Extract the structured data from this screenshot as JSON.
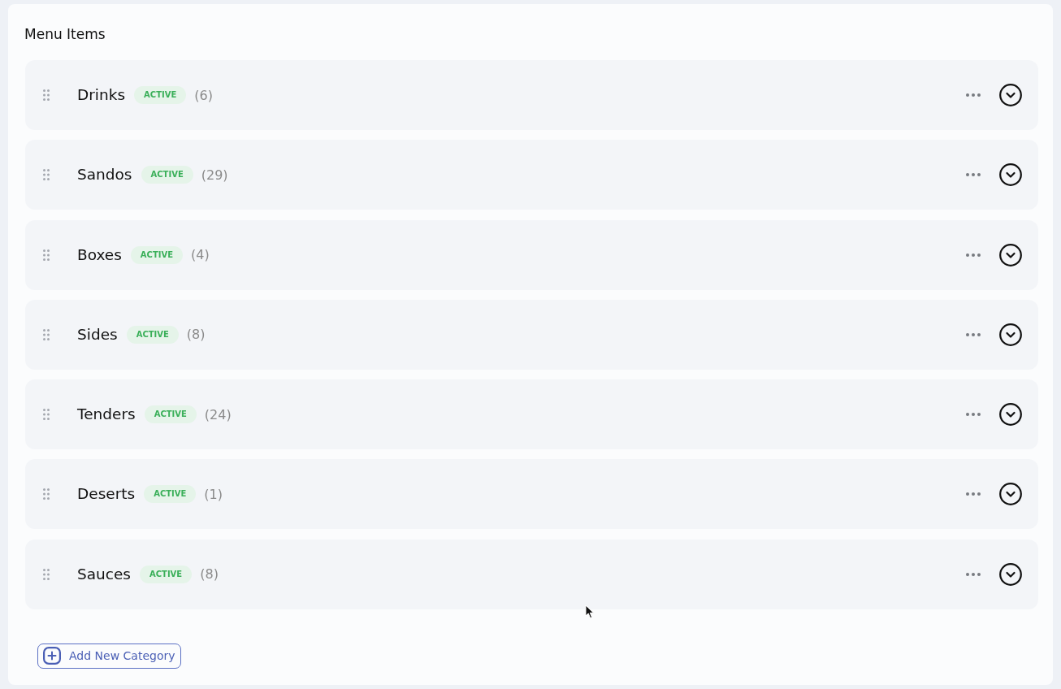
{
  "section": {
    "title": "Menu Items"
  },
  "categories": [
    {
      "name": "Drinks",
      "status": "ACTIVE",
      "active": true,
      "count": "(6)",
      "expanded": false
    },
    {
      "name": "Sandos",
      "status": "ACTIVE",
      "active": true,
      "count": "(29)",
      "expanded": false
    },
    {
      "name": "Boxes",
      "status": "ACTIVE",
      "active": true,
      "count": "(4)",
      "expanded": false
    },
    {
      "name": "Sides",
      "status": "ACTIVE",
      "active": true,
      "count": "(8)",
      "expanded": false
    },
    {
      "name": "Tenders",
      "status": "ACTIVE",
      "active": true,
      "count": "(24)",
      "expanded": false
    },
    {
      "name": "Deserts",
      "status": "ACTIVE",
      "active": true,
      "count": "(1)",
      "expanded": false
    },
    {
      "name": "Sauces",
      "status": "ACTIVE",
      "active": true,
      "count": "(8)",
      "expanded": false
    }
  ],
  "add_button": {
    "label": "Add New Category"
  }
}
